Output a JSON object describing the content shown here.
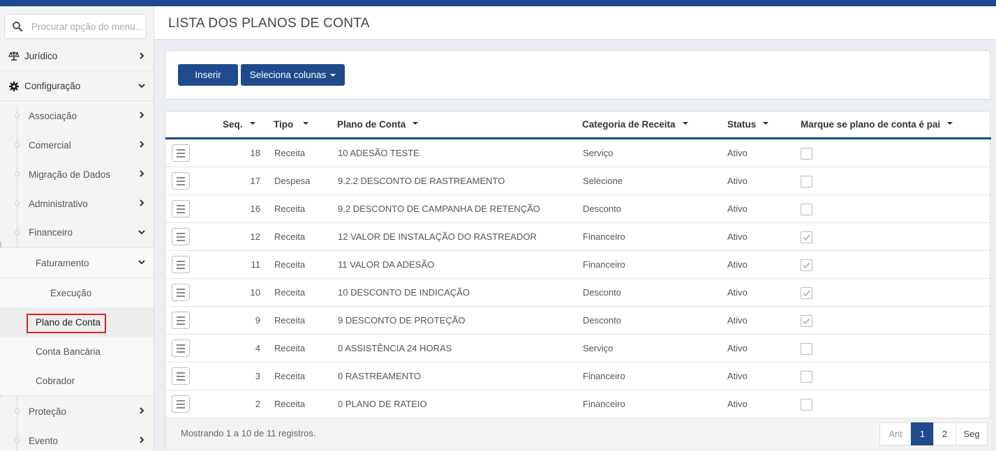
{
  "search": {
    "placeholder": "Procurar opção do menu..."
  },
  "sidebar": {
    "items": [
      {
        "label": "Jurídico"
      },
      {
        "label": "Configuração"
      },
      {
        "label": "Associação"
      },
      {
        "label": "Comercial"
      },
      {
        "label": "Migração de Dados"
      },
      {
        "label": "Administrativo"
      },
      {
        "label": "Financeiro"
      },
      {
        "label": "Faturamento"
      },
      {
        "label": "Execução"
      },
      {
        "label": "Plano de Conta"
      },
      {
        "label": "Conta Bancária"
      },
      {
        "label": "Cobrador"
      },
      {
        "label": "Proteção"
      },
      {
        "label": "Evento"
      }
    ]
  },
  "header": {
    "title": "LISTA DOS PLANOS DE CONTA"
  },
  "toolbar": {
    "insert_label": "Inserir",
    "columns_label": "Seleciona colunas"
  },
  "table": {
    "columns": [
      "Seq.",
      "Tipo",
      "Plano de Conta",
      "Categoria de Receita",
      "Status",
      "Marque se plano de conta é pai"
    ],
    "rows": [
      {
        "seq": "18",
        "tipo": "Receita",
        "plano": "10 ADESÃO TESTE",
        "categoria": "Serviço",
        "status": "Ativo",
        "pai": false
      },
      {
        "seq": "17",
        "tipo": "Despesa",
        "plano": "9.2.2 DESCONTO DE RASTREAMENTO",
        "categoria": "Selecione",
        "status": "Ativo",
        "pai": false
      },
      {
        "seq": "16",
        "tipo": "Receita",
        "plano": "9.2 DESCONTO DE CAMPANHA DE RETENÇÃO",
        "categoria": "Desconto",
        "status": "Ativo",
        "pai": false
      },
      {
        "seq": "12",
        "tipo": "Receita",
        "plano": "12 VALOR DE INSTALAÇÃO DO RASTREADOR",
        "categoria": "Financeiro",
        "status": "Ativo",
        "pai": true
      },
      {
        "seq": "11",
        "tipo": "Receita",
        "plano": "11 VALOR DA ADESÃO",
        "categoria": "Financeiro",
        "status": "Ativo",
        "pai": true
      },
      {
        "seq": "10",
        "tipo": "Receita",
        "plano": "10 DESCONTO DE INDICAÇÃO",
        "categoria": "Desconto",
        "status": "Ativo",
        "pai": true
      },
      {
        "seq": "9",
        "tipo": "Receita",
        "plano": "9 DESCONTO DE PROTEÇÃO",
        "categoria": "Desconto",
        "status": "Ativo",
        "pai": true
      },
      {
        "seq": "4",
        "tipo": "Receita",
        "plano": "0 ASSISTÊNCIA 24 HORAS",
        "categoria": "Serviço",
        "status": "Ativo",
        "pai": false
      },
      {
        "seq": "3",
        "tipo": "Receita",
        "plano": "0 RASTREAMENTO",
        "categoria": "Financeiro",
        "status": "Ativo",
        "pai": false
      },
      {
        "seq": "2",
        "tipo": "Receita",
        "plano": "0 PLANO DE RATEIO",
        "categoria": "Financeiro",
        "status": "Ativo",
        "pai": false
      }
    ]
  },
  "footer": {
    "info": "Mostrando 1 a 10 de 11 registros."
  },
  "pagination": {
    "prev": "Ant",
    "pages": [
      "1",
      "2"
    ],
    "next": "Seg"
  },
  "colors": {
    "accent": "#1f4a8c",
    "highlight": "#e02020"
  }
}
